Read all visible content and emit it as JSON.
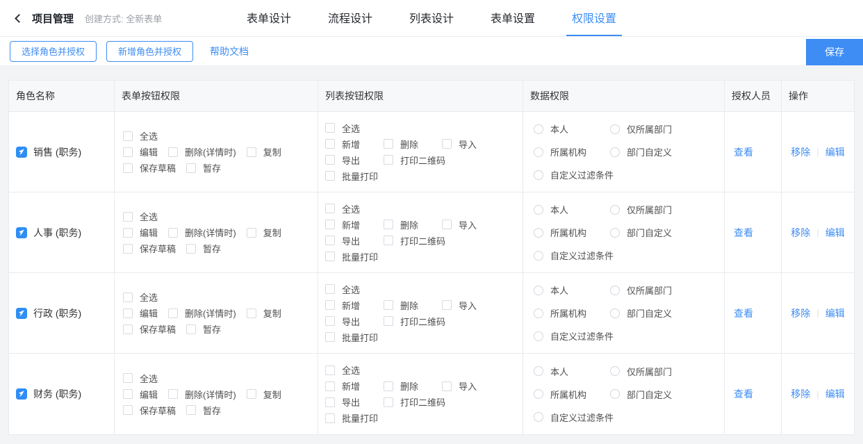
{
  "colors": {
    "accent": "#3d8df5",
    "page_background": "#f3f4f6",
    "table_border": "#e8eaec",
    "table_header_background": "#f7f8fa",
    "muted_text": "#9a9fa6"
  },
  "header": {
    "back_icon": "chevron-left",
    "title": "项目管理",
    "subtitle": "创建方式: 全新表单",
    "tabs": [
      {
        "label": "表单设计",
        "active": false
      },
      {
        "label": "流程设计",
        "active": false
      },
      {
        "label": "列表设计",
        "active": false
      },
      {
        "label": "表单设置",
        "active": false
      },
      {
        "label": "权限设置",
        "active": true
      }
    ]
  },
  "toolbar": {
    "select_role_button": "选择角色并授权",
    "add_role_button": "新增角色并授权",
    "help_link": "帮助文档",
    "save_button": "保存"
  },
  "table": {
    "columns": [
      "角色名称",
      "表单按钮权限",
      "列表按钮权限",
      "数据权限",
      "授权人员",
      "操作"
    ],
    "form_button_lines": [
      [
        "全选"
      ],
      [
        "编辑",
        "删除(详情时)",
        "复制"
      ],
      [
        "保存草稿",
        "暂存"
      ]
    ],
    "list_button_lines": [
      [
        "全选"
      ],
      [
        "新增",
        "删除",
        "导入"
      ],
      [
        "导出",
        "打印二维码"
      ],
      [
        "批量打印"
      ]
    ],
    "data_permission_lines": [
      [
        "本人",
        "仅所属部门"
      ],
      [
        "所属机构",
        "部门自定义"
      ],
      [
        "自定义过滤条件"
      ]
    ],
    "rows": [
      {
        "name": "销售 (职务)",
        "checkboxes_checked": false,
        "radio_selected": false
      },
      {
        "name": "人事 (职务)",
        "checkboxes_checked": false,
        "radio_selected": false
      },
      {
        "name": "行政 (职务)",
        "checkboxes_checked": false,
        "radio_selected": false
      },
      {
        "name": "财务 (职务)",
        "checkboxes_checked": false,
        "radio_selected": false
      }
    ],
    "view_link": "查看",
    "remove_link": "移除",
    "edit_link": "编辑",
    "ops_divider": "|"
  }
}
